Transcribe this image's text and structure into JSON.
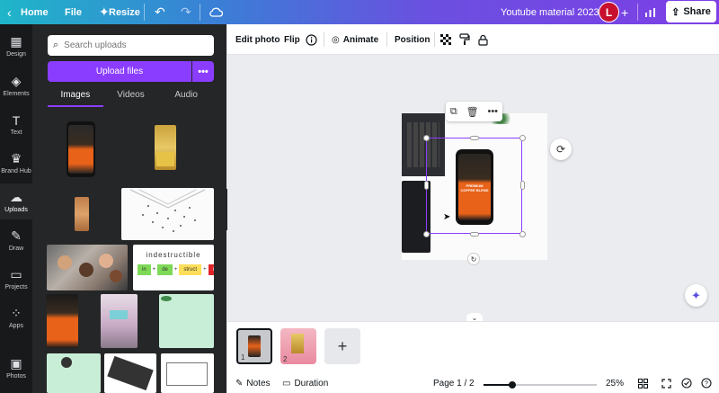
{
  "topbar": {
    "back_icon": "chevron-left-icon",
    "home_label": "Home",
    "file_label": "File",
    "resize_label": "Resize",
    "undo_icon": "undo-icon",
    "redo_icon": "redo-icon",
    "cloud_icon": "cloud-sync-icon",
    "doc_title": "Youtube material 2023",
    "avatar_initial": "L",
    "add_icon": "plus-icon",
    "analytics_icon": "bar-chart-icon",
    "share_label": "Share"
  },
  "rail": {
    "items": [
      {
        "label": "Design",
        "icon": "layout-icon"
      },
      {
        "label": "Elements",
        "icon": "shapes-icon"
      },
      {
        "label": "Text",
        "icon": "text-icon"
      },
      {
        "label": "Brand Hub",
        "icon": "crown-icon"
      },
      {
        "label": "Uploads",
        "icon": "cloud-upload-icon"
      },
      {
        "label": "Draw",
        "icon": "pen-icon"
      },
      {
        "label": "Projects",
        "icon": "folder-icon"
      },
      {
        "label": "Apps",
        "icon": "apps-icon"
      },
      {
        "label": "Photos",
        "icon": "image-icon"
      }
    ],
    "active": "Uploads"
  },
  "panel": {
    "search_placeholder": "Search uploads",
    "upload_label": "Upload files",
    "more_label": "•••",
    "tabs": [
      "Images",
      "Videos",
      "Audio"
    ],
    "active_tab": "Images",
    "indestructible_word": "indestructible",
    "indestructible_parts": [
      "in",
      "de",
      "struct",
      "ible"
    ]
  },
  "toolbar": {
    "edit_photo": "Edit photo",
    "flip": "Flip",
    "info_icon": "info-icon",
    "animate": "Animate",
    "position": "Position",
    "transparency_icon": "checkerboard-icon",
    "paint_icon": "paint-roller-icon",
    "lock_icon": "lock-icon"
  },
  "canvas": {
    "phone_text": "PREMIUM COFFEE BLEND",
    "float_tools": [
      "copy-icon",
      "trash-icon",
      "more-icon"
    ]
  },
  "pages": {
    "items": [
      {
        "num": "1"
      },
      {
        "num": "2"
      }
    ],
    "add_label": "+"
  },
  "bottombar": {
    "notes_label": "Notes",
    "duration_label": "Duration",
    "page_indicator": "Page 1 / 2",
    "zoom_label": "25%",
    "zoom_fraction": 0.25
  },
  "colors": {
    "accent": "#8b3dff",
    "avatar": "#c8102e",
    "rail_bg": "#18191b",
    "panel_bg": "#252627"
  }
}
